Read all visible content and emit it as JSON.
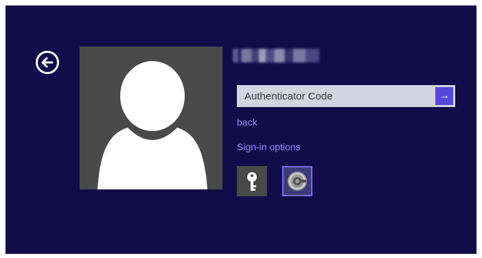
{
  "signin": {
    "username": "",
    "code_placeholder": "Authenticator Code",
    "submit_icon": "→",
    "back_link": "back",
    "options_link": "Sign-in options"
  },
  "icons": {
    "back": "back-arrow-icon",
    "user": "user-silhouette-icon",
    "key": "key-icon",
    "authenticator": "authenticator-icon"
  },
  "colors": {
    "background": "#130c4a",
    "accent": "#5548d8",
    "link": "#9b8cff",
    "field": "#d4d3e1",
    "selected_border": "#7b6cf0"
  }
}
